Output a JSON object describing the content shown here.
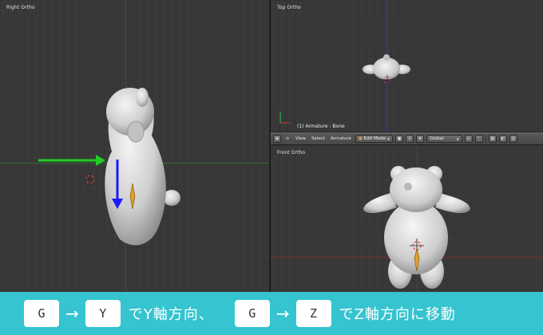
{
  "viewports": {
    "right": {
      "label": "Right Ortho"
    },
    "top": {
      "label": "Top Ortho",
      "info": "(1) Armature : Bone"
    },
    "front": {
      "label": "Front Ortho"
    }
  },
  "header": {
    "menus": [
      "View",
      "Select",
      "Armature"
    ],
    "mode": "Edit Mode",
    "orientation": "Global"
  },
  "banner": {
    "step1_key1": "G",
    "step1_key2": "Y",
    "step1_text": "でY軸方向、",
    "step2_key1": "G",
    "step2_key2": "Z",
    "step2_text": "でZ軸方向に移動",
    "arrow": "→"
  },
  "colors": {
    "banner_bg": "#35c4d0",
    "arrow_green": "#22cc22",
    "arrow_blue": "#1a1aff",
    "bone": "#e0a030"
  }
}
